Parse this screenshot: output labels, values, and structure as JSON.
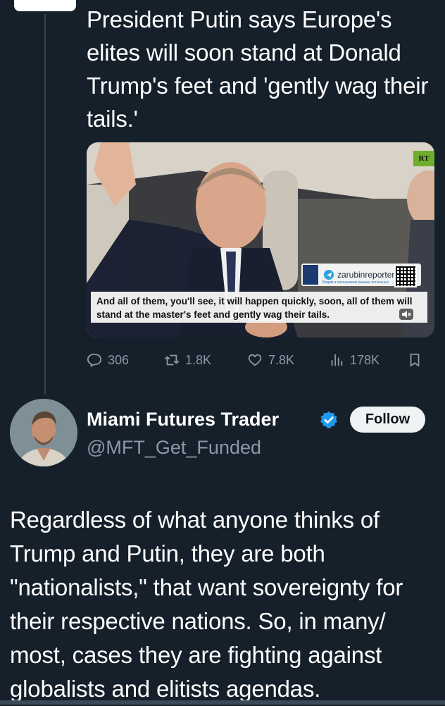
{
  "quoted_post": {
    "text": "President Putin says Europe's elites will soon stand at Donald Trump's feet and 'gently wag their tails.'"
  },
  "video": {
    "channel_badge": "RT",
    "channel_name": "zarubinreporter",
    "channel_subtext": "Видим и показываем раньше остальных",
    "subtitle": "And all of them, you'll see, it will happen quickly, soon, all of them will stand at the master's feet and gently wag their tails."
  },
  "actions": {
    "replies": "306",
    "reposts": "1.8K",
    "likes": "7.8K",
    "views": "178K"
  },
  "author": {
    "name": "Miami Futures Trader",
    "handle": "@MFT_Get_Funded",
    "follow_label": "Follow"
  },
  "tweet": {
    "text": "Regardless of what anyone thinks of Trump and Putin, they are both \"nationalists,\" that want sovereignty for their respective nations. So, in many/ most, cases they are fighting against globalists and elitists agendas."
  },
  "colors": {
    "background": "#15202b",
    "text": "#ffffff",
    "secondary_text": "#8b98a5",
    "verified": "#1d9bf0",
    "follow_bg": "#eff3f4"
  }
}
